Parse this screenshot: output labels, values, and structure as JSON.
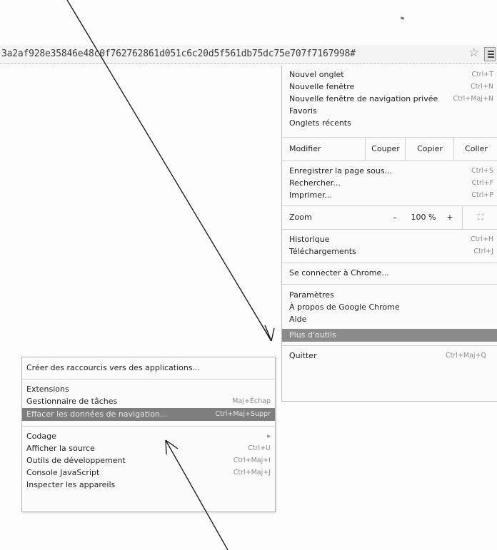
{
  "address_bar": {
    "url": "3a2af928e35846e48c0f762762861d051c6c20d5f561db75dc75e707f7167998#"
  },
  "icons": {
    "star": "star-icon",
    "menu": "hamburger-menu-icon",
    "submenu_arrow": "chevron-right-icon"
  },
  "menu": {
    "items_top": [
      {
        "label": "Nouvel onglet",
        "shortcut": "Ctrl+T"
      },
      {
        "label": "Nouvelle fenêtre",
        "shortcut": "Ctrl+N"
      },
      {
        "label": "Nouvelle fenêtre de navigation privée",
        "shortcut": "Ctrl+Maj+N"
      },
      {
        "label": "Favoris",
        "shortcut": ""
      },
      {
        "label": "Onglets récents",
        "shortcut": ""
      }
    ],
    "edit": {
      "label": "Modifier",
      "cut": "Couper",
      "copy": "Copier",
      "paste": "Coller"
    },
    "items_page": [
      {
        "label": "Enregistrer la page sous...",
        "shortcut": "Ctrl+S"
      },
      {
        "label": "Rechercher...",
        "shortcut": "Ctrl+F"
      },
      {
        "label": "Imprimer...",
        "shortcut": "Ctrl+P"
      }
    ],
    "zoom": {
      "label": "Zoom",
      "minus": "-",
      "value": "100 %",
      "plus": "+",
      "fullscreen": "⛶"
    },
    "items_history": [
      {
        "label": "Historique",
        "shortcut": "Ctrl+H"
      },
      {
        "label": "Téléchargements",
        "shortcut": "Ctrl+J"
      }
    ],
    "signin": "Se connecter à Chrome...",
    "items_settings": [
      {
        "label": "Paramètres",
        "shortcut": ""
      },
      {
        "label": "À propos de Google Chrome",
        "shortcut": ""
      },
      {
        "label": "Aide",
        "shortcut": ""
      }
    ],
    "more_tools": "Plus d'outils",
    "quit": {
      "label": "Quitter",
      "shortcut": "Ctrl+Maj+Q"
    }
  },
  "submenu": {
    "create_shortcuts": "Créer des raccourcis vers des applications...",
    "extensions": "Extensions",
    "task_manager": {
      "label": "Gestionnaire de tâches",
      "shortcut": "Maj+Échap"
    },
    "clear_data": {
      "label": "Effacer les données de navigation...",
      "shortcut": "Ctrl+Maj+Suppr"
    },
    "encoding": "Codage",
    "view_source": {
      "label": "Afficher la source",
      "shortcut": "Ctrl+U"
    },
    "dev_tools": {
      "label": "Outils de développement",
      "shortcut": "Ctrl+Maj+I"
    },
    "js_console": {
      "label": "Console JavaScript",
      "shortcut": "Ctrl+Maj+J"
    },
    "inspect_devices": "Inspecter les appareils"
  }
}
